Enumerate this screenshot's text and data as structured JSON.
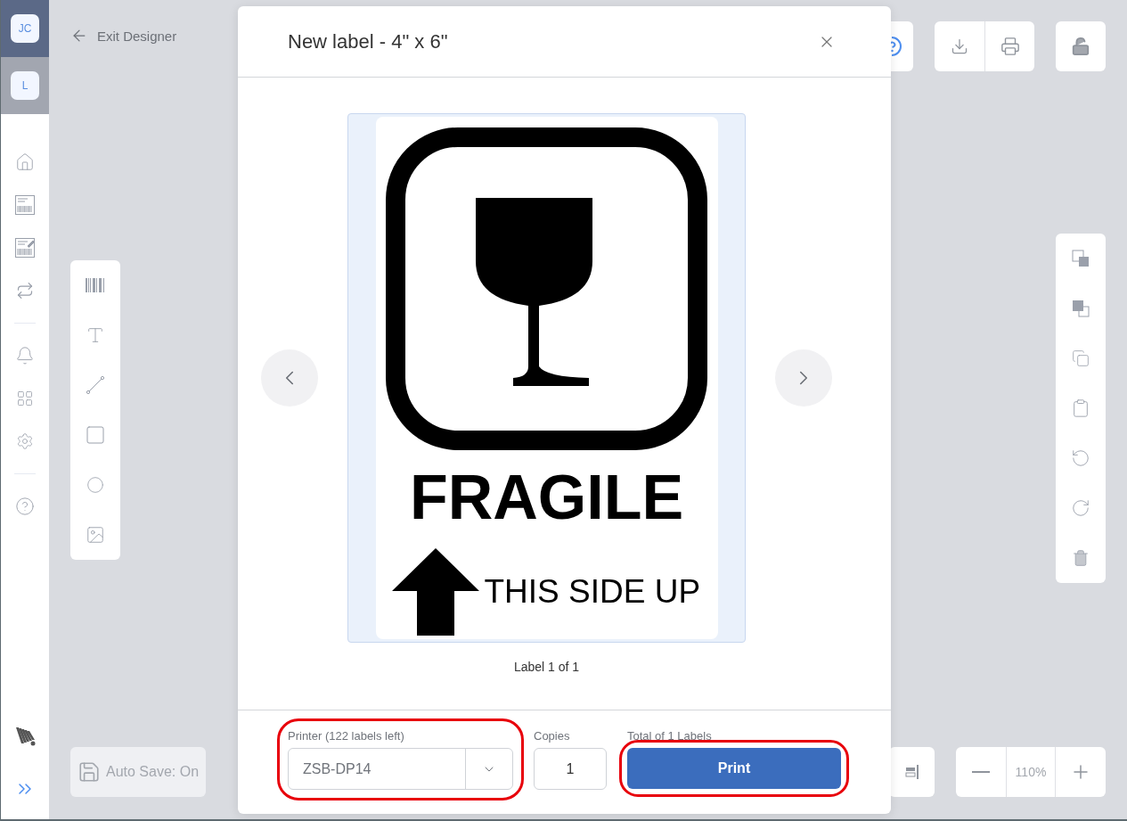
{
  "sidebar": {
    "avatars": [
      {
        "initials": "JC",
        "selected": true
      },
      {
        "initials": "L",
        "selected": false
      }
    ]
  },
  "header": {
    "back_link": "Exit Designer"
  },
  "autosave": {
    "label": "Auto Save: On"
  },
  "zoom": {
    "value": "110%"
  },
  "dialog": {
    "title": "New label - 4\" x 6\"",
    "preview": {
      "headline": "FRAGILE",
      "orientation_text": "THIS SIDE UP",
      "page_indicator": "Label 1 of 1"
    },
    "printer": {
      "label": "Printer (122 labels left)",
      "value": "ZSB-DP14",
      "highlighted": true
    },
    "copies": {
      "label": "Copies",
      "value": "1"
    },
    "total": {
      "label": "Total of 1 Labels",
      "button": "Print",
      "highlighted": true
    }
  }
}
